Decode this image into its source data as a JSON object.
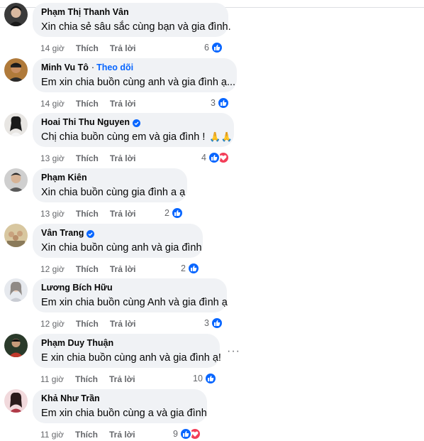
{
  "colors": {
    "like_blue": "#0866ff",
    "love_red": "#f33e58",
    "bubble_bg": "#f0f2f5",
    "meta_gray": "#65676b"
  },
  "action_labels": {
    "like": "Thích",
    "reply": "Trả lời"
  },
  "comments": [
    {
      "author": "Phạm Thị Thanh Vân",
      "text": "Xin chia sẻ sâu sắc cùng bạn và gia đình.",
      "time": "14 giờ",
      "reaction_count": "6",
      "reactions": [
        "like-icon"
      ]
    },
    {
      "author": "Minh Vu Tô",
      "follow_sep": "·",
      "follow_label": "Theo dõi",
      "text": "Em xin chia buồn cùng anh và gia đình ạ...",
      "time": "14 giờ",
      "reaction_count": "3",
      "reactions": [
        "like-icon"
      ]
    },
    {
      "author": "Hoai Thi Thu Nguyen",
      "verified": true,
      "text": "Chị chia buồn cùng em và gia đình !",
      "emoji": "🙏🙏",
      "time": "13 giờ",
      "reaction_count": "4",
      "reactions": [
        "like-icon",
        "love-icon"
      ]
    },
    {
      "author": "Phạm Kiên",
      "text": "Xin chia buồn cùng gia đình a ạ",
      "time": "13 giờ",
      "reaction_count": "2",
      "reactions": [
        "like-icon"
      ]
    },
    {
      "author": "Vân Trang",
      "verified": true,
      "text": "Xin chia buồn cùng anh và gia đình",
      "time": "12 giờ",
      "reaction_count": "2",
      "reactions": [
        "like-icon"
      ]
    },
    {
      "author": "Lương Bích Hữu",
      "text": "Em xin chia buồn cùng Anh và gia đình ạ",
      "time": "12 giờ",
      "reaction_count": "3",
      "reactions": [
        "like-icon"
      ]
    },
    {
      "author": "Phạm Duy Thuận",
      "text": "E xin chia buồn cùng anh và gia đình ạ!",
      "time": "11 giờ",
      "reaction_count": "10",
      "reactions": [
        "like-icon"
      ],
      "more_label": "···"
    },
    {
      "author": "Khả Như Trần",
      "text": "Em xin chia buồn cùng a và gia đình",
      "time": "11 giờ",
      "reaction_count": "9",
      "reactions": [
        "like-icon",
        "love-icon"
      ]
    }
  ]
}
